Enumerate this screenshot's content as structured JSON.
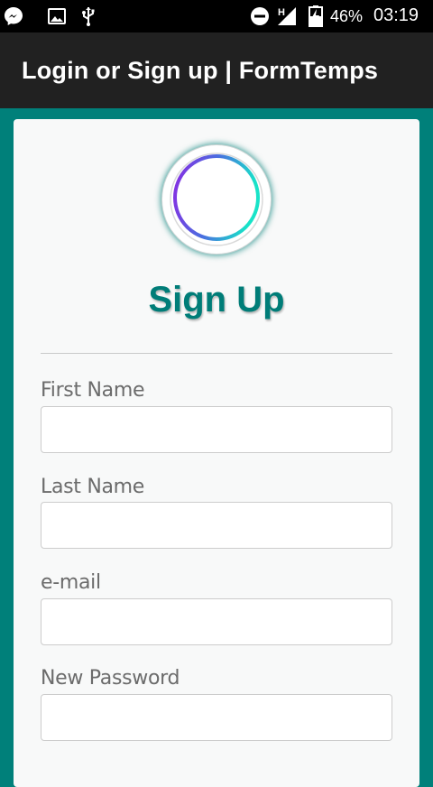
{
  "status_bar": {
    "icons_left": [
      "messenger-icon",
      "image-icon",
      "usb-icon"
    ],
    "icons_right": [
      "do-not-disturb-icon",
      "signal-icon",
      "battery-icon"
    ],
    "network_label": "H",
    "battery": "46%",
    "time": "03:19"
  },
  "app_bar": {
    "title": "Login or Sign up | FormTemps"
  },
  "form": {
    "title": "Sign Up",
    "fields": [
      {
        "label": "First Name",
        "value": ""
      },
      {
        "label": "Last Name",
        "value": ""
      },
      {
        "label": "e-mail",
        "value": ""
      },
      {
        "label": "New Password",
        "value": ""
      }
    ]
  },
  "colors": {
    "background": "#00807a",
    "accent": "#007d78",
    "app_bar": "#212121",
    "card": "#f8f9f9"
  }
}
